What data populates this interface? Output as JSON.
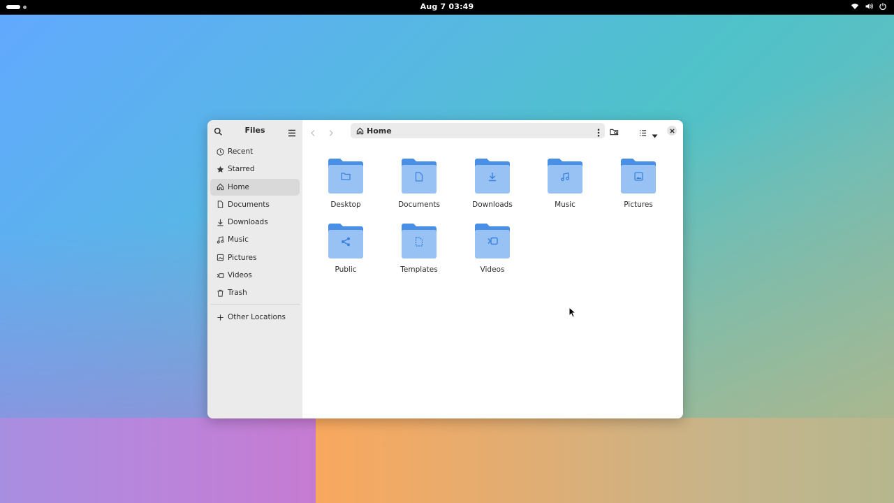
{
  "topbar": {
    "clock": "Aug 7  03:49"
  },
  "window": {
    "sidebar": {
      "title": "Files",
      "items": [
        {
          "label": "Recent",
          "icon": "clock-icon"
        },
        {
          "label": "Starred",
          "icon": "star-icon"
        },
        {
          "label": "Home",
          "icon": "home-icon",
          "active": true
        },
        {
          "label": "Documents",
          "icon": "document-icon"
        },
        {
          "label": "Downloads",
          "icon": "download-icon"
        },
        {
          "label": "Music",
          "icon": "music-icon"
        },
        {
          "label": "Pictures",
          "icon": "picture-icon"
        },
        {
          "label": "Videos",
          "icon": "video-icon"
        },
        {
          "label": "Trash",
          "icon": "trash-icon"
        }
      ],
      "other_locations": "Other Locations"
    },
    "pathbar": {
      "label": "Home"
    },
    "folders": [
      {
        "label": "Desktop",
        "emblem": "folder-emblem-icon"
      },
      {
        "label": "Documents",
        "emblem": "document-emblem-icon"
      },
      {
        "label": "Downloads",
        "emblem": "download-emblem-icon"
      },
      {
        "label": "Music",
        "emblem": "music-emblem-icon"
      },
      {
        "label": "Pictures",
        "emblem": "picture-emblem-icon"
      },
      {
        "label": "Public",
        "emblem": "share-emblem-icon"
      },
      {
        "label": "Templates",
        "emblem": "template-emblem-icon"
      },
      {
        "label": "Videos",
        "emblem": "video-emblem-icon"
      }
    ]
  },
  "colors": {
    "folder_back": "#4a8fe6",
    "folder_front": "#98c2f3",
    "emblem": "#3b82dc",
    "sidebar_bg": "#ebebeb",
    "active_item": "#d9d9d9",
    "topbar": "#000000"
  }
}
